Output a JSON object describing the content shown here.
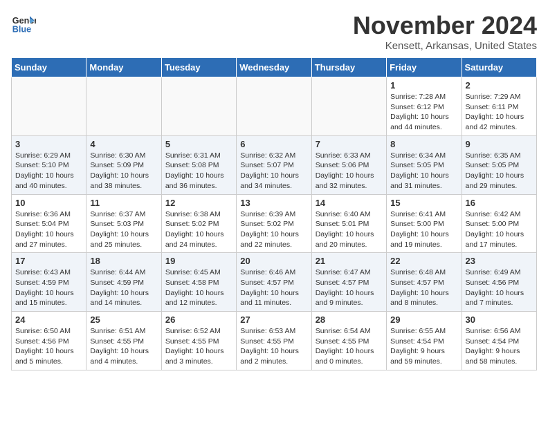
{
  "logo": {
    "line1": "General",
    "line2": "Blue"
  },
  "title": "November 2024",
  "location": "Kensett, Arkansas, United States",
  "weekdays": [
    "Sunday",
    "Monday",
    "Tuesday",
    "Wednesday",
    "Thursday",
    "Friday",
    "Saturday"
  ],
  "weeks": [
    [
      {
        "day": "",
        "content": ""
      },
      {
        "day": "",
        "content": ""
      },
      {
        "day": "",
        "content": ""
      },
      {
        "day": "",
        "content": ""
      },
      {
        "day": "",
        "content": ""
      },
      {
        "day": "1",
        "content": "Sunrise: 7:28 AM\nSunset: 6:12 PM\nDaylight: 10 hours\nand 44 minutes."
      },
      {
        "day": "2",
        "content": "Sunrise: 7:29 AM\nSunset: 6:11 PM\nDaylight: 10 hours\nand 42 minutes."
      }
    ],
    [
      {
        "day": "3",
        "content": "Sunrise: 6:29 AM\nSunset: 5:10 PM\nDaylight: 10 hours\nand 40 minutes."
      },
      {
        "day": "4",
        "content": "Sunrise: 6:30 AM\nSunset: 5:09 PM\nDaylight: 10 hours\nand 38 minutes."
      },
      {
        "day": "5",
        "content": "Sunrise: 6:31 AM\nSunset: 5:08 PM\nDaylight: 10 hours\nand 36 minutes."
      },
      {
        "day": "6",
        "content": "Sunrise: 6:32 AM\nSunset: 5:07 PM\nDaylight: 10 hours\nand 34 minutes."
      },
      {
        "day": "7",
        "content": "Sunrise: 6:33 AM\nSunset: 5:06 PM\nDaylight: 10 hours\nand 32 minutes."
      },
      {
        "day": "8",
        "content": "Sunrise: 6:34 AM\nSunset: 5:05 PM\nDaylight: 10 hours\nand 31 minutes."
      },
      {
        "day": "9",
        "content": "Sunrise: 6:35 AM\nSunset: 5:05 PM\nDaylight: 10 hours\nand 29 minutes."
      }
    ],
    [
      {
        "day": "10",
        "content": "Sunrise: 6:36 AM\nSunset: 5:04 PM\nDaylight: 10 hours\nand 27 minutes."
      },
      {
        "day": "11",
        "content": "Sunrise: 6:37 AM\nSunset: 5:03 PM\nDaylight: 10 hours\nand 25 minutes."
      },
      {
        "day": "12",
        "content": "Sunrise: 6:38 AM\nSunset: 5:02 PM\nDaylight: 10 hours\nand 24 minutes."
      },
      {
        "day": "13",
        "content": "Sunrise: 6:39 AM\nSunset: 5:02 PM\nDaylight: 10 hours\nand 22 minutes."
      },
      {
        "day": "14",
        "content": "Sunrise: 6:40 AM\nSunset: 5:01 PM\nDaylight: 10 hours\nand 20 minutes."
      },
      {
        "day": "15",
        "content": "Sunrise: 6:41 AM\nSunset: 5:00 PM\nDaylight: 10 hours\nand 19 minutes."
      },
      {
        "day": "16",
        "content": "Sunrise: 6:42 AM\nSunset: 5:00 PM\nDaylight: 10 hours\nand 17 minutes."
      }
    ],
    [
      {
        "day": "17",
        "content": "Sunrise: 6:43 AM\nSunset: 4:59 PM\nDaylight: 10 hours\nand 15 minutes."
      },
      {
        "day": "18",
        "content": "Sunrise: 6:44 AM\nSunset: 4:59 PM\nDaylight: 10 hours\nand 14 minutes."
      },
      {
        "day": "19",
        "content": "Sunrise: 6:45 AM\nSunset: 4:58 PM\nDaylight: 10 hours\nand 12 minutes."
      },
      {
        "day": "20",
        "content": "Sunrise: 6:46 AM\nSunset: 4:57 PM\nDaylight: 10 hours\nand 11 minutes."
      },
      {
        "day": "21",
        "content": "Sunrise: 6:47 AM\nSunset: 4:57 PM\nDaylight: 10 hours\nand 9 minutes."
      },
      {
        "day": "22",
        "content": "Sunrise: 6:48 AM\nSunset: 4:57 PM\nDaylight: 10 hours\nand 8 minutes."
      },
      {
        "day": "23",
        "content": "Sunrise: 6:49 AM\nSunset: 4:56 PM\nDaylight: 10 hours\nand 7 minutes."
      }
    ],
    [
      {
        "day": "24",
        "content": "Sunrise: 6:50 AM\nSunset: 4:56 PM\nDaylight: 10 hours\nand 5 minutes."
      },
      {
        "day": "25",
        "content": "Sunrise: 6:51 AM\nSunset: 4:55 PM\nDaylight: 10 hours\nand 4 minutes."
      },
      {
        "day": "26",
        "content": "Sunrise: 6:52 AM\nSunset: 4:55 PM\nDaylight: 10 hours\nand 3 minutes."
      },
      {
        "day": "27",
        "content": "Sunrise: 6:53 AM\nSunset: 4:55 PM\nDaylight: 10 hours\nand 2 minutes."
      },
      {
        "day": "28",
        "content": "Sunrise: 6:54 AM\nSunset: 4:55 PM\nDaylight: 10 hours\nand 0 minutes."
      },
      {
        "day": "29",
        "content": "Sunrise: 6:55 AM\nSunset: 4:54 PM\nDaylight: 9 hours\nand 59 minutes."
      },
      {
        "day": "30",
        "content": "Sunrise: 6:56 AM\nSunset: 4:54 PM\nDaylight: 9 hours\nand 58 minutes."
      }
    ]
  ]
}
